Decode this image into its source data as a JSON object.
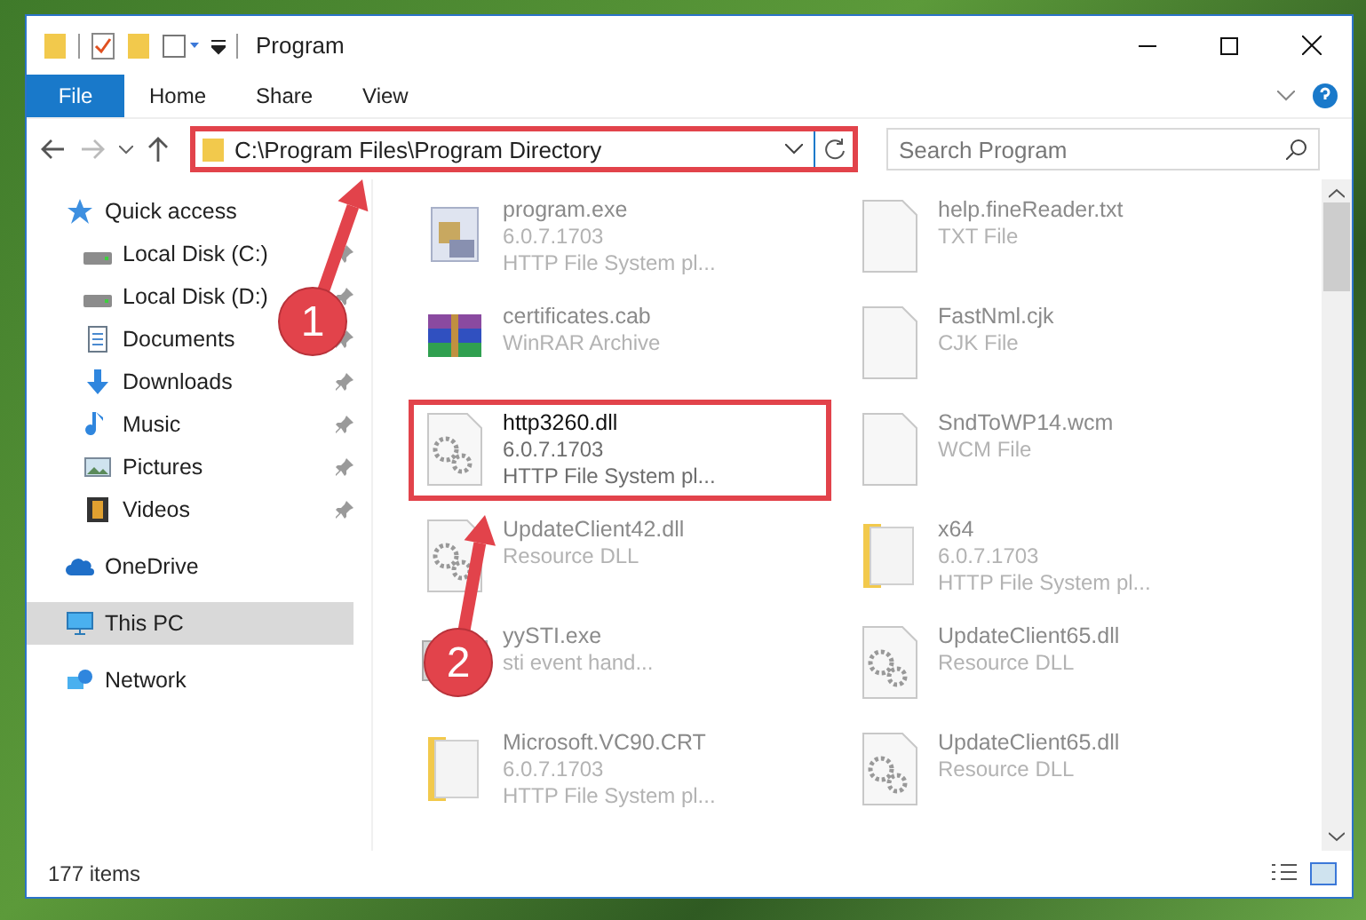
{
  "window": {
    "title": "Program"
  },
  "ribbon_tabs": [
    {
      "label": "File",
      "kind": "file",
      "selected": false
    },
    {
      "label": "Home",
      "kind": "tab",
      "selected": false
    },
    {
      "label": "Share",
      "kind": "tab",
      "selected": false
    },
    {
      "label": "View",
      "kind": "tab",
      "selected": false
    }
  ],
  "address_bar": {
    "path": "C:\\Program Files\\Program Directory",
    "highlighted": true
  },
  "search": {
    "placeholder": "Search Program"
  },
  "sidebar": [
    {
      "label": "Quick access",
      "kind": "star",
      "selected": false,
      "children": [
        {
          "label": "Local Disk (C:)",
          "kind": "disk",
          "pinned": true,
          "selected": false
        },
        {
          "label": "Local Disk (D:)",
          "kind": "disk",
          "pinned": true,
          "selected": false
        },
        {
          "label": "Documents",
          "kind": "document",
          "pinned": true,
          "selected": false
        },
        {
          "label": "Downloads",
          "kind": "download",
          "pinned": true,
          "selected": false
        },
        {
          "label": "Music",
          "kind": "music",
          "pinned": true,
          "selected": false
        },
        {
          "label": "Pictures",
          "kind": "picture",
          "pinned": true,
          "selected": false
        },
        {
          "label": "Videos",
          "kind": "video",
          "pinned": true,
          "selected": false
        }
      ]
    },
    {
      "label": "OneDrive",
      "kind": "cloud",
      "selected": false
    },
    {
      "label": "This PC",
      "kind": "monitor",
      "selected": true
    },
    {
      "label": "Network",
      "kind": "network",
      "selected": false
    }
  ],
  "files": [
    {
      "name": "program.exe",
      "details": [
        "6.0.7.1703",
        "HTTP File System pl..."
      ],
      "kind": "exe",
      "highlighted": false
    },
    {
      "name": "help.fineReader.txt",
      "details": [
        "TXT File"
      ],
      "kind": "blank",
      "highlighted": false
    },
    {
      "name": "certificates.cab",
      "details": [
        "WinRAR Archive"
      ],
      "kind": "archive",
      "highlighted": false
    },
    {
      "name": "FastNml.cjk",
      "details": [
        "CJK File"
      ],
      "kind": "blank",
      "highlighted": false
    },
    {
      "name": "http3260.dll",
      "details": [
        "6.0.7.1703",
        "HTTP File System pl..."
      ],
      "kind": "dll",
      "highlighted": true
    },
    {
      "name": "SndToWP14.wcm",
      "details": [
        "WCM File"
      ],
      "kind": "blank",
      "highlighted": false
    },
    {
      "name": "UpdateClient42.dll",
      "details": [
        "Resource DLL"
      ],
      "kind": "dll",
      "highlighted": false
    },
    {
      "name": "x64",
      "details": [
        "6.0.7.1703",
        "HTTP File System pl..."
      ],
      "kind": "folder",
      "highlighted": false
    },
    {
      "name": "yySTI.exe",
      "details": [
        "sti event hand..."
      ],
      "kind": "app",
      "highlighted": false
    },
    {
      "name": "UpdateClient65.dll",
      "details": [
        "Resource DLL"
      ],
      "kind": "dll",
      "highlighted": false
    },
    {
      "name": "Microsoft.VC90.CRT",
      "details": [
        "6.0.7.1703",
        "HTTP File System pl..."
      ],
      "kind": "folder",
      "highlighted": false
    },
    {
      "name": "UpdateClient65.dll",
      "details": [
        "Resource DLL"
      ],
      "kind": "dll",
      "highlighted": false
    }
  ],
  "status_bar": {
    "item_count": "177 items"
  },
  "callouts": [
    {
      "number": "1"
    },
    {
      "number": "2"
    }
  ]
}
